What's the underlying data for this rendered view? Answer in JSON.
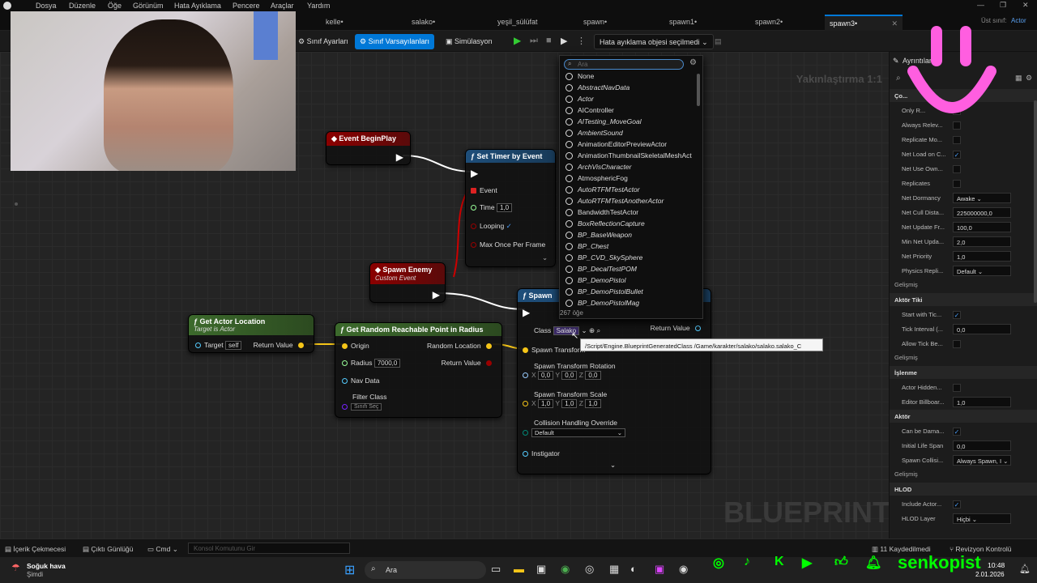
{
  "menu": [
    "Dosya",
    "Düzenle",
    "Öğe",
    "Görünüm",
    "Hata Ayıklama",
    "Pencere",
    "Araçlar",
    "Yardım"
  ],
  "tabs": [
    {
      "label": "kelle•"
    },
    {
      "label": "salako•"
    },
    {
      "label": "yeşil_sülüfat"
    },
    {
      "label": "spawn•"
    },
    {
      "label": "spawn1•"
    },
    {
      "label": "spawn2•"
    },
    {
      "label": "spawn3•",
      "active": true
    }
  ],
  "parent_class": {
    "label": "Üst sınıf:",
    "value": "Actor"
  },
  "toolbar": {
    "class_settings": "Sınıf Ayarları",
    "class_defaults": "Sınıf Varsayılanları",
    "simulation": "Simülasyon",
    "debug_object": "Hata ayıklama objesi seçilmedi"
  },
  "graph": {
    "zoom": "Yakınlaştırma 1:1",
    "watermark": "BLUEPRINT",
    "event_beginplay": "Event BeginPlay",
    "set_timer": {
      "title": "Set Timer by Event",
      "event": "Event",
      "time_label": "Time",
      "time_value": "1,0",
      "looping": "Looping",
      "max_once": "Max Once Per Frame"
    },
    "spawn_enemy": {
      "title": "Spawn Enemy",
      "subtitle": "Custom Event"
    },
    "get_actor_location": {
      "title": "Get Actor Location",
      "subtitle": "Target is Actor",
      "target": "Target",
      "target_value": "self",
      "return": "Return Value"
    },
    "get_random_point": {
      "title": "Get Random Reachable Point in Radius",
      "origin": "Origin",
      "radius": "Radius",
      "radius_value": "7000,0",
      "nav_data": "Nav Data",
      "filter_class": "Filter Class",
      "filter_value": "Sınıfı Seç",
      "random_location": "Random Location",
      "return": "Return Value"
    },
    "spawn_actor": {
      "title": "Spawn",
      "class_label": "Class",
      "class_value": "Salako",
      "return": "Return Value",
      "transform": "Spawn Transform",
      "rotation": "Spawn Transform Rotation",
      "rotation_values": [
        "0,0",
        "0,0",
        "0,0"
      ],
      "scale": "Spawn Transform Scale",
      "scale_values": [
        "1,0",
        "1,0",
        "1,0"
      ],
      "collision": "Collision Handling Override",
      "collision_value": "Default",
      "instigator": "Instigator"
    },
    "tooltip": "/Script/Engine.BlueprintGeneratedClass /Game/karakter/salako/salako.salako_C"
  },
  "dropdown": {
    "search_placeholder": "Ara",
    "items": [
      {
        "label": "None",
        "italic": false
      },
      {
        "label": "AbstractNavData",
        "italic": true
      },
      {
        "label": "Actor",
        "italic": true
      },
      {
        "label": "AIController",
        "italic": false
      },
      {
        "label": "AITesting_MoveGoal",
        "italic": true
      },
      {
        "label": "AmbientSound",
        "italic": true
      },
      {
        "label": "AnimationEditorPreviewActor",
        "italic": false
      },
      {
        "label": "AnimationThumbnailSkeletalMeshAct",
        "italic": false
      },
      {
        "label": "ArchVisCharacter",
        "italic": true
      },
      {
        "label": "AtmosphericFog",
        "italic": false
      },
      {
        "label": "AutoRTFMTestActor",
        "italic": true
      },
      {
        "label": "AutoRTFMTestAnotherActor",
        "italic": true
      },
      {
        "label": "BandwidthTestActor",
        "italic": false
      },
      {
        "label": "BoxReflectionCapture",
        "italic": true
      },
      {
        "label": "BP_BaseWeapon",
        "italic": true
      },
      {
        "label": "BP_Chest",
        "italic": true
      },
      {
        "label": "BP_CVD_SkySphere",
        "italic": true
      },
      {
        "label": "BP_DecalTestPOM",
        "italic": true
      },
      {
        "label": "BP_DemoPistol",
        "italic": true
      },
      {
        "label": "BP_DemoPistolBullet",
        "italic": true
      },
      {
        "label": "BP_DemoPistolMag",
        "italic": true
      }
    ],
    "count": "267 öğe"
  },
  "details": {
    "title": "Ayrıntılar",
    "rows": [
      {
        "type": "section",
        "label": "Ço..."
      },
      {
        "type": "check",
        "label": "Only R...",
        "checked": false
      },
      {
        "type": "check",
        "label": "Always Relev...",
        "checked": false
      },
      {
        "type": "check",
        "label": "Replicate Mo...",
        "checked": false
      },
      {
        "type": "check",
        "label": "Net Load on C...",
        "checked": true
      },
      {
        "type": "check",
        "label": "Net Use Own...",
        "checked": false
      },
      {
        "type": "check",
        "label": "Replicates",
        "checked": false
      },
      {
        "type": "value",
        "label": "Net Dormancy",
        "value": "Awake ⌄"
      },
      {
        "type": "value",
        "label": "Net Cull Dista...",
        "value": "225000000,0"
      },
      {
        "type": "value",
        "label": "Net Update Fr...",
        "value": "100,0"
      },
      {
        "type": "value",
        "label": "Min Net Upda...",
        "value": "2,0"
      },
      {
        "type": "value",
        "label": "Net Priority",
        "value": "1,0"
      },
      {
        "type": "value",
        "label": "Physics Repli...",
        "value": "Default ⌄"
      },
      {
        "type": "sub",
        "label": "Gelişmiş"
      },
      {
        "type": "section",
        "label": "Aktör Tiki"
      },
      {
        "type": "check",
        "label": "Start with Tic...",
        "checked": true
      },
      {
        "type": "value",
        "label": "Tick Interval (...",
        "value": "0,0"
      },
      {
        "type": "check",
        "label": "Allow Tick Be...",
        "checked": false
      },
      {
        "type": "sub",
        "label": "Gelişmiş"
      },
      {
        "type": "section",
        "label": "İşlenme"
      },
      {
        "type": "check",
        "label": "Actor Hidden...",
        "checked": false
      },
      {
        "type": "value",
        "label": "Editor Billboar...",
        "value": "1,0"
      },
      {
        "type": "section",
        "label": "Aktör"
      },
      {
        "type": "check",
        "label": "Can be Dama...",
        "checked": true
      },
      {
        "type": "value",
        "label": "Initial Life Span",
        "value": "0,0"
      },
      {
        "type": "value",
        "label": "Spawn Collisi...",
        "value": "Always Spawn, I ⌄"
      },
      {
        "type": "sub",
        "label": "Gelişmiş"
      },
      {
        "type": "section",
        "label": "HLOD"
      },
      {
        "type": "check",
        "label": "Include Actor...",
        "checked": true
      },
      {
        "type": "value",
        "label": "HLOD Layer",
        "value": "Hiçbi ⌄"
      }
    ]
  },
  "statusbar": {
    "content_drawer": "İçerik Çekmecesi",
    "output_log": "Çıktı Günlüğü",
    "cmd": "Cmd",
    "console_placeholder": "Konsol Komutunu Gir",
    "saved": "11 Kaydedilmedi",
    "revision": "Revizyon Kontrolü"
  },
  "taskbar": {
    "weather": "Soğuk hava",
    "weather_sub": "Şimdi",
    "search": "Ara",
    "time": "10:48",
    "date": "2.01.2026"
  },
  "overlay": {
    "handle": "senkopist"
  }
}
